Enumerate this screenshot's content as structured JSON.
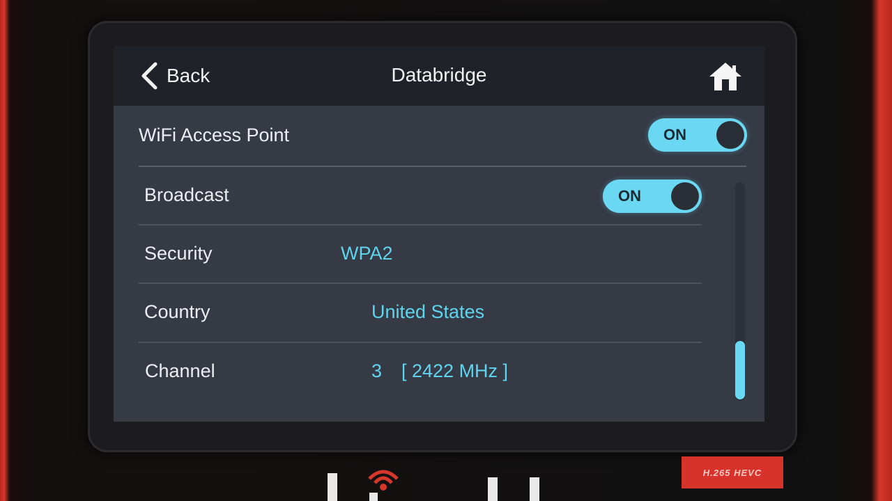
{
  "header": {
    "back_label": "Back",
    "title": "Databridge"
  },
  "settings": {
    "wifi_access_point": {
      "label": "WiFi Access Point",
      "toggle": "ON"
    },
    "broadcast": {
      "label": "Broadcast",
      "toggle": "ON"
    },
    "security": {
      "label": "Security",
      "value": "WPA2"
    },
    "country": {
      "label": "Country",
      "value": "United States"
    },
    "channel": {
      "label": "Channel",
      "number": "3",
      "frequency": "[ 2422 MHz ]"
    }
  },
  "device": {
    "badge": "H.265 HEVC"
  },
  "colors": {
    "accent": "#6ad8f3",
    "value_text": "#5fd4ee",
    "screen_bg": "#353a45",
    "header_bg": "#1f2229",
    "device_red": "#d6372a"
  },
  "icons": {
    "back": "chevron-left-icon",
    "home": "home-icon"
  }
}
